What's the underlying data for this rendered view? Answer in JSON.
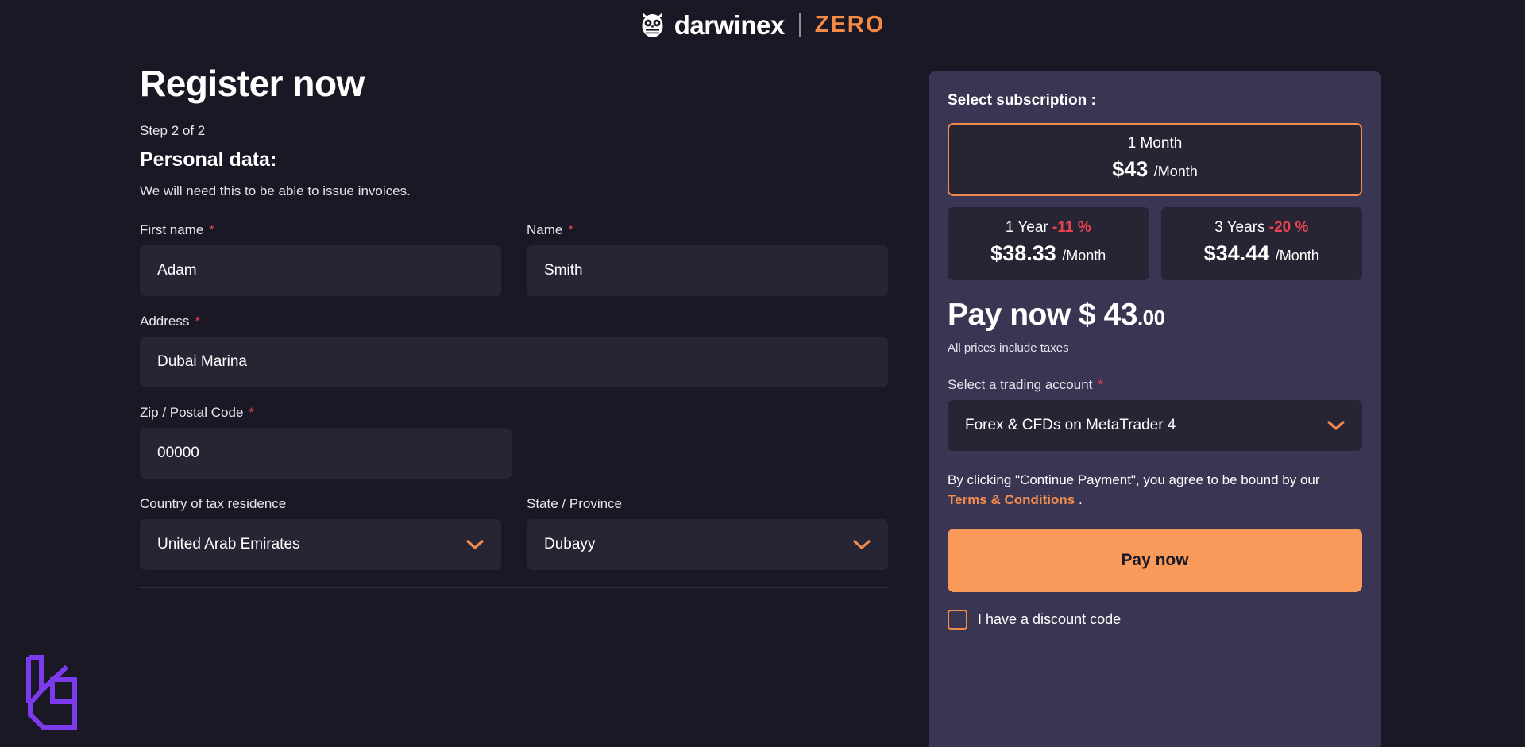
{
  "brand": {
    "owl_icon": "owl-icon",
    "name": "darwinex",
    "product": "ZERO",
    "accent": "#f58a47"
  },
  "form": {
    "title": "Register now",
    "step": "Step 2 of 2",
    "section_title": "Personal data:",
    "section_subtitle": "We will need this to be able to issue invoices.",
    "required_mark": "*",
    "fields": [
      {
        "label": "First name",
        "value": "Adam",
        "required": true
      },
      {
        "label": "Name",
        "value": "Smith",
        "required": true
      },
      {
        "label": "Address",
        "value": "Dubai Marina",
        "required": true
      },
      {
        "label": "Zip / Postal Code",
        "value": "00000",
        "required": true
      },
      {
        "label": "Country of tax residence",
        "value": "United Arab Emirates",
        "required": false
      },
      {
        "label": "State / Province",
        "value": "Dubayy",
        "required": false
      }
    ]
  },
  "summary": {
    "title": "Select subscription :",
    "plans": [
      {
        "name": "1 Month",
        "discount": "",
        "price": "$43",
        "per": "/Month",
        "selected": true
      },
      {
        "name": "1 Year",
        "discount": "-11 %",
        "price": "$38.33",
        "per": "/Month",
        "selected": false
      },
      {
        "name": "3 Years",
        "discount": "-20 %",
        "price": "$34.44",
        "per": "/Month",
        "selected": false
      }
    ],
    "pay_now_label": "Pay now $ 43",
    "pay_now_cents": ".00",
    "taxes_note": "All prices include taxes",
    "account_label": "Select a trading account",
    "account_value": "Forex & CFDs on MetaTrader 4",
    "terms_prefix": "By clicking \"Continue Payment\", you agree to be bound by our ",
    "terms_link": "Terms & Conditions",
    "terms_suffix": " .",
    "pay_button": "Pay now",
    "discount_label": "I have a discount code",
    "discount_checked": false,
    "accent": "#f08b4d",
    "danger": "#e8434f"
  },
  "watermark": {
    "icon": "lc-monogram-icon",
    "color": "#7c3aed"
  }
}
